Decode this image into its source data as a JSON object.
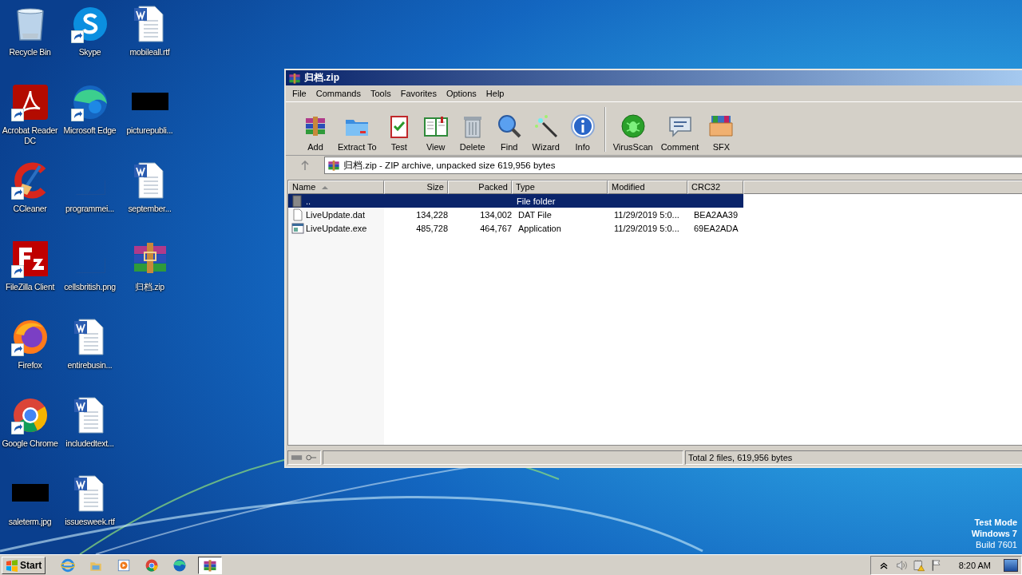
{
  "desktop": {
    "icons": [
      {
        "label": "Recycle Bin",
        "kind": "recycle",
        "shortcut": false
      },
      {
        "label": "Acrobat Reader DC",
        "kind": "acrobat",
        "shortcut": true
      },
      {
        "label": "CCleaner",
        "kind": "ccleaner",
        "shortcut": true
      },
      {
        "label": "FileZilla Client",
        "kind": "filezilla",
        "shortcut": true
      },
      {
        "label": "Firefox",
        "kind": "firefox",
        "shortcut": true
      },
      {
        "label": "Google Chrome",
        "kind": "chrome",
        "shortcut": true
      },
      {
        "label": "saleterm.jpg",
        "kind": "dark",
        "shortcut": false
      },
      {
        "label": "Skype",
        "kind": "skype",
        "shortcut": true
      },
      {
        "label": "Microsoft Edge",
        "kind": "edge",
        "shortcut": true
      },
      {
        "label": "programmei...",
        "kind": "blank",
        "shortcut": false
      },
      {
        "label": "cellsbritish.png",
        "kind": "blank",
        "shortcut": false
      },
      {
        "label": "entirebusin...",
        "kind": "word",
        "shortcut": false
      },
      {
        "label": "includedtext...",
        "kind": "word",
        "shortcut": false
      },
      {
        "label": "issuesweek.rtf",
        "kind": "word",
        "shortcut": false
      },
      {
        "label": "mobileall.rtf",
        "kind": "word",
        "shortcut": false
      },
      {
        "label": "picturepubli...",
        "kind": "dark",
        "shortcut": false
      },
      {
        "label": "september...",
        "kind": "word",
        "shortcut": false
      },
      {
        "label": "归档.zip",
        "kind": "winrar",
        "shortcut": false
      }
    ]
  },
  "window": {
    "title": "归档.zip",
    "menu": [
      "File",
      "Commands",
      "Tools",
      "Favorites",
      "Options",
      "Help"
    ],
    "toolbar": [
      [
        {
          "label": "Add",
          "kind": "add"
        },
        {
          "label": "Extract To",
          "kind": "extract"
        },
        {
          "label": "Test",
          "kind": "test"
        },
        {
          "label": "View",
          "kind": "view"
        },
        {
          "label": "Delete",
          "kind": "delete"
        },
        {
          "label": "Find",
          "kind": "find"
        },
        {
          "label": "Wizard",
          "kind": "wizard"
        },
        {
          "label": "Info",
          "kind": "info"
        }
      ],
      [
        {
          "label": "VirusScan",
          "kind": "virus"
        },
        {
          "label": "Comment",
          "kind": "comment"
        },
        {
          "label": "SFX",
          "kind": "sfx"
        }
      ]
    ],
    "address": "归档.zip - ZIP archive, unpacked size 619,956 bytes",
    "columns": [
      {
        "label": "Name",
        "sorted": true
      },
      {
        "label": "Size",
        "sorted": false
      },
      {
        "label": "Packed",
        "sorted": false
      },
      {
        "label": "Type",
        "sorted": false
      },
      {
        "label": "Modified",
        "sorted": false
      },
      {
        "label": "CRC32",
        "sorted": false
      }
    ],
    "rows": [
      {
        "kind": "folder",
        "selected": true,
        "cells": [
          "..",
          "",
          "",
          "File folder",
          "",
          ""
        ]
      },
      {
        "kind": "file",
        "selected": false,
        "cells": [
          "LiveUpdate.dat",
          "134,228",
          "134,002",
          "DAT File",
          "11/29/2019 5:0...",
          "BEA2AA39"
        ]
      },
      {
        "kind": "app",
        "selected": false,
        "cells": [
          "LiveUpdate.exe",
          "485,728",
          "464,767",
          "Application",
          "11/29/2019 5:0...",
          "69EA2ADA"
        ]
      }
    ],
    "status": "Total 2 files, 619,956 bytes"
  },
  "system_notice": [
    "Test Mode",
    "Windows 7",
    "Build 7601"
  ],
  "taskbar": {
    "start": "Start",
    "items": [
      {
        "kind": "ie",
        "active": false
      },
      {
        "kind": "explorer",
        "active": false
      },
      {
        "kind": "media",
        "active": false
      },
      {
        "kind": "chrome",
        "active": false
      },
      {
        "kind": "edge",
        "active": false
      },
      {
        "kind": "winrar",
        "active": true
      }
    ],
    "tray": [
      {
        "kind": "chevron"
      },
      {
        "kind": "speaker"
      },
      {
        "kind": "network"
      },
      {
        "kind": "flag"
      }
    ],
    "clock": "8:20 AM"
  }
}
